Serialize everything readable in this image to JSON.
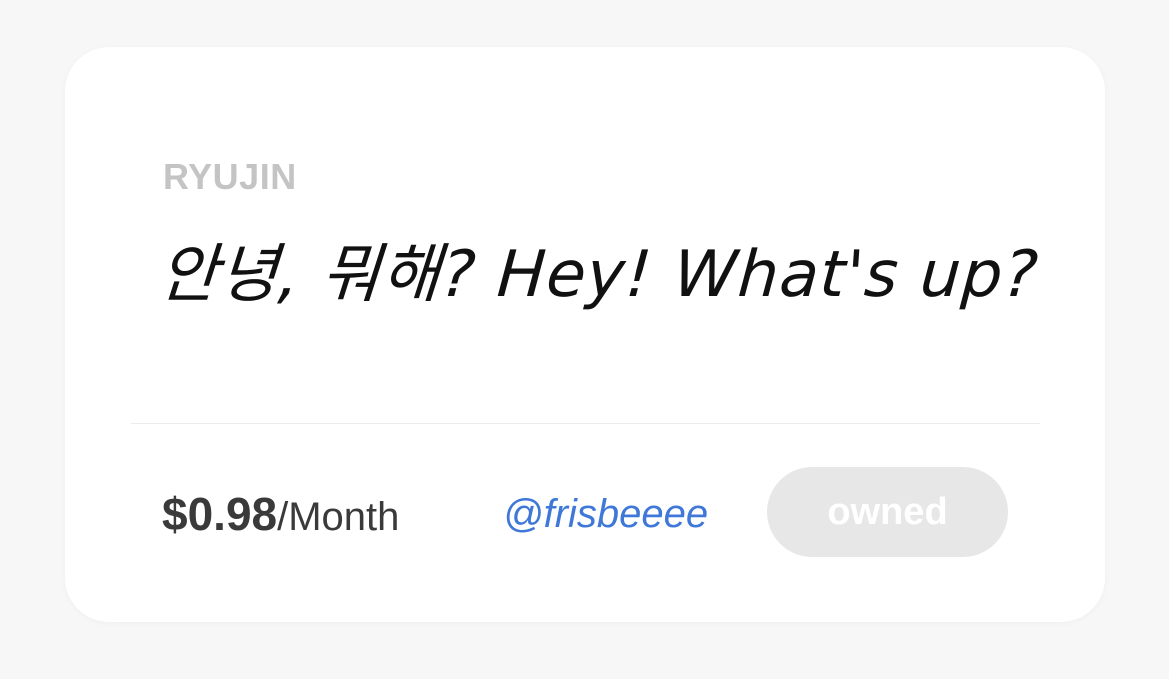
{
  "card": {
    "artist": "RYUJIN",
    "sample_text": "안녕, 뭐해?  Hey! What's up?",
    "price": {
      "amount": "$0.98",
      "period": "/Month"
    },
    "designer_handle": "@frisbeeee",
    "status_button": "owned"
  },
  "colors": {
    "background": "#f7f7f7",
    "card": "#ffffff",
    "artist_text": "#c4c4c4",
    "handle_link": "#3f78d8",
    "button_bg": "#e7e7e7"
  }
}
